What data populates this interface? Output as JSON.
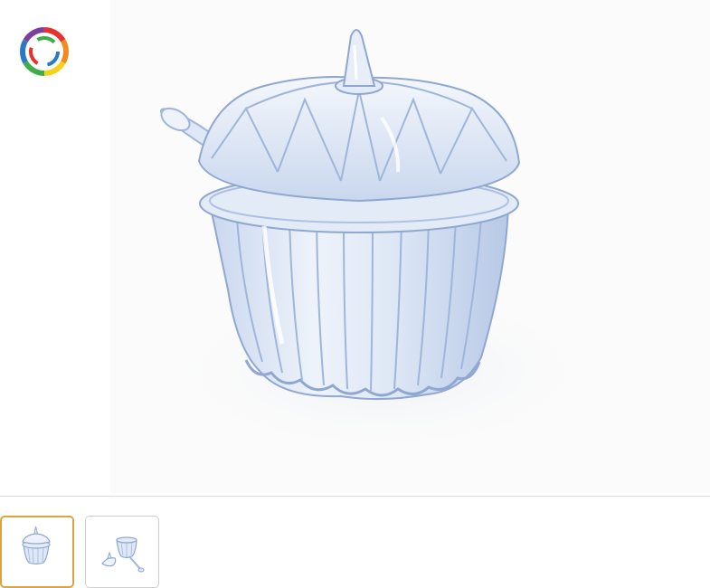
{
  "product_gallery": {
    "main_image": {
      "icon": "crystal-sugar-bowl-with-lid-and-spoon"
    },
    "brand_logo": {
      "icon": "rainbow-swirl-logo"
    },
    "thumbnails": [
      {
        "icon": "sugar-bowl-thumbnail",
        "selected": true
      },
      {
        "icon": "sugar-bowl-open-thumbnail",
        "selected": false
      }
    ]
  },
  "colors": {
    "selected_thumbnail_border": "#d9a441",
    "thumbnail_border": "#cfcfcf",
    "glass_tint": "#b8cbe8"
  }
}
